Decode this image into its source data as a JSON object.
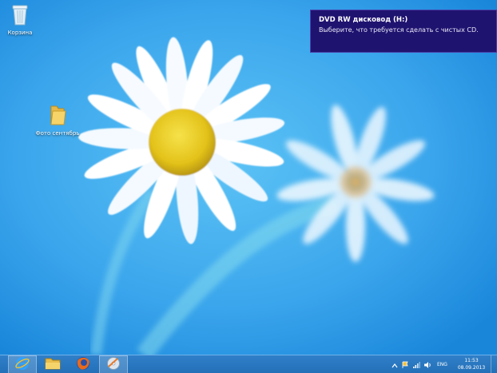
{
  "desktop": {
    "icons": [
      {
        "label": "Корзина",
        "icon": "recycle-bin-icon"
      },
      {
        "label": "Фото сентябрь",
        "icon": "folder-icon"
      }
    ]
  },
  "notification": {
    "title": "DVD RW дисковод (H:)",
    "body": "Выберите, что требуется сделать с чистых CD."
  },
  "taskbar": {
    "pinned": [
      {
        "name": "internet-explorer",
        "icon": "ie-icon",
        "active": true
      },
      {
        "name": "file-explorer",
        "icon": "folder-icon",
        "active": false
      },
      {
        "name": "firefox",
        "icon": "firefox-icon",
        "active": false
      },
      {
        "name": "disc-burner",
        "icon": "disc-icon",
        "active": true
      }
    ],
    "tray": {
      "language": "ENG",
      "time": "11:53",
      "date": "08.09.2013"
    }
  },
  "colors": {
    "toast_bg": "#1f1370",
    "taskbar_bg": "#2470b8",
    "wallpaper_sky": "#3aa7ee"
  }
}
